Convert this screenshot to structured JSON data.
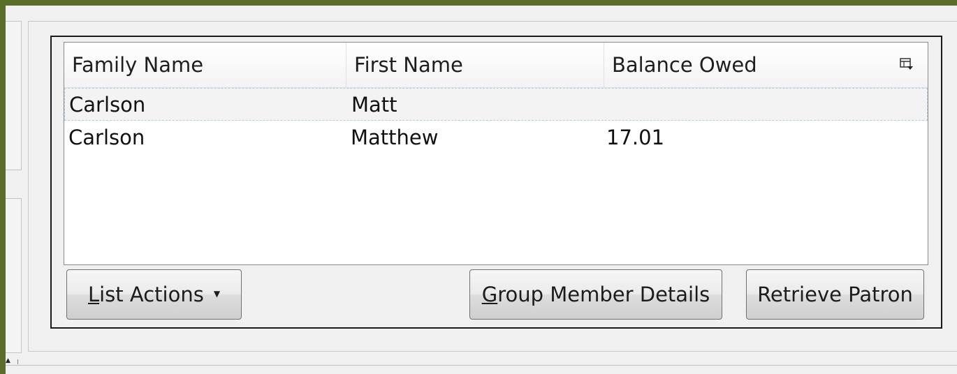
{
  "table": {
    "columns": [
      "Family Name",
      "First Name",
      "Balance Owed"
    ],
    "column_picker_icon": "column-picker-icon",
    "rows": [
      {
        "family_name": "Carlson",
        "first_name": "Matt",
        "balance_owed": "",
        "selected": true
      },
      {
        "family_name": "Carlson",
        "first_name": "Matthew",
        "balance_owed": "17.01",
        "selected": false
      }
    ]
  },
  "buttons": {
    "list_actions": {
      "mnemonic": "L",
      "rest": "ist Actions"
    },
    "group_member_details": {
      "mnemonic": "G",
      "rest": "roup Member Details"
    },
    "retrieve_patron": "Retrieve Patron"
  },
  "colors": {
    "background_frame": "#5a6e2a",
    "selection_border": "#a9d0e6"
  }
}
